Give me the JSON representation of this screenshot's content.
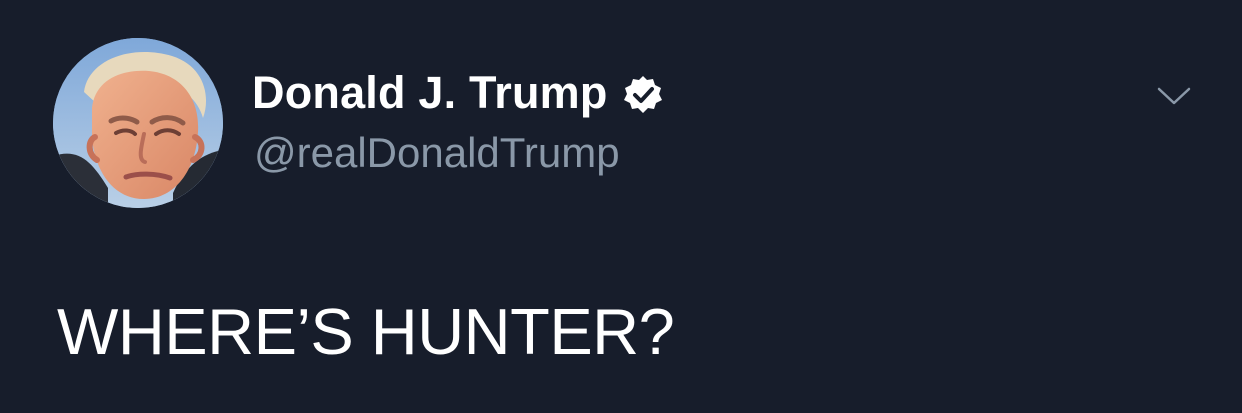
{
  "theme": {
    "background": "#171d2b",
    "text_primary": "#ffffff",
    "text_secondary": "#8a98a8",
    "verified_badge": "#ffffff"
  },
  "tweet": {
    "author": {
      "display_name": "Donald J. Trump",
      "handle": "@realDonaldTrump",
      "verified": true,
      "avatar_icon": "profile-photo-portrait",
      "verified_icon": "verified-badge-icon"
    },
    "text": "WHERE’S HUNTER?",
    "menu_icon": "chevron-down-icon"
  }
}
